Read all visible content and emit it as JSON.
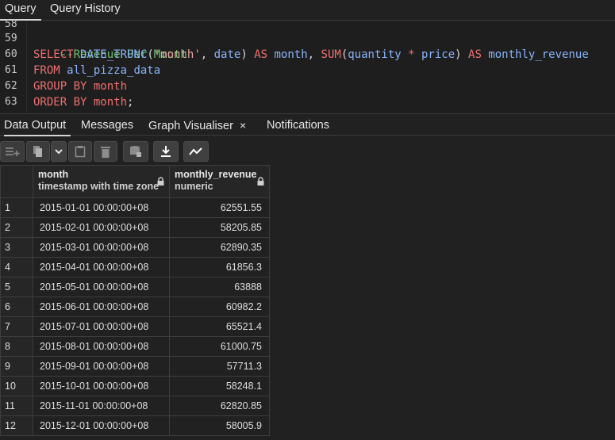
{
  "top_tabs": [
    "Query",
    "Query History"
  ],
  "editor": {
    "line_numbers": [
      "58",
      "59",
      "60",
      "61",
      "62",
      "63"
    ],
    "comment": "--Revenue Per Month",
    "select_kw": "SELECT",
    "date_trunc": "DATE_TRUNC",
    "month_str": "'month'",
    "date_col": "date",
    "as_kw": "AS",
    "month_alias": "month",
    "sum_fn": "SUM",
    "quantity": "quantity",
    "times": "*",
    "price": "price",
    "as_kw2": "AS",
    "monthly_revenue": "monthly_revenue",
    "from_kw": "FROM",
    "table": "all_pizza_data",
    "group_by": "GROUP BY",
    "group_col": "month",
    "order_by": "ORDER BY",
    "order_col": "month"
  },
  "result_tabs": {
    "data_output": "Data Output",
    "messages": "Messages",
    "graph": "Graph Visualiser",
    "graph_close": "×",
    "notifications": "Notifications"
  },
  "toolbar_icons": [
    "add-row-icon",
    "copy-icon",
    "dropdown-chevron-icon",
    "paste-icon",
    "delete-icon",
    "save-data-icon",
    "download-icon",
    "graph-icon"
  ],
  "grid": {
    "columns": [
      {
        "name": "month",
        "type": "timestamp with time zone"
      },
      {
        "name": "monthly_revenue",
        "type": "numeric"
      }
    ],
    "rows": [
      {
        "n": "1",
        "month": "2015-01-01 00:00:00+08",
        "revenue": "62551.55"
      },
      {
        "n": "2",
        "month": "2015-02-01 00:00:00+08",
        "revenue": "58205.85"
      },
      {
        "n": "3",
        "month": "2015-03-01 00:00:00+08",
        "revenue": "62890.35"
      },
      {
        "n": "4",
        "month": "2015-04-01 00:00:00+08",
        "revenue": "61856.3"
      },
      {
        "n": "5",
        "month": "2015-05-01 00:00:00+08",
        "revenue": "63888"
      },
      {
        "n": "6",
        "month": "2015-06-01 00:00:00+08",
        "revenue": "60982.2"
      },
      {
        "n": "7",
        "month": "2015-07-01 00:00:00+08",
        "revenue": "65521.4"
      },
      {
        "n": "8",
        "month": "2015-08-01 00:00:00+08",
        "revenue": "61000.75"
      },
      {
        "n": "9",
        "month": "2015-09-01 00:00:00+08",
        "revenue": "57711.3"
      },
      {
        "n": "10",
        "month": "2015-10-01 00:00:00+08",
        "revenue": "58248.1"
      },
      {
        "n": "11",
        "month": "2015-11-01 00:00:00+08",
        "revenue": "62820.85"
      },
      {
        "n": "12",
        "month": "2015-12-01 00:00:00+08",
        "revenue": "58005.9"
      }
    ]
  }
}
